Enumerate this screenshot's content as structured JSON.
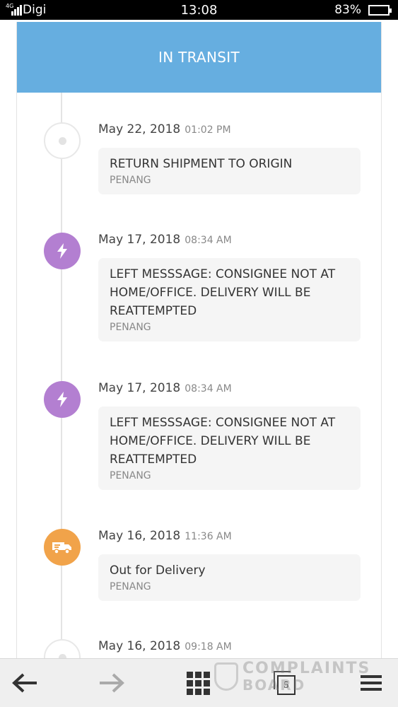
{
  "status_bar": {
    "signal_tag": "4G",
    "carrier": "Digi",
    "time": "13:08",
    "battery": "83%",
    "battery_level": 0.83
  },
  "header": {
    "title": "IN TRANSIT",
    "color": "#66aee0"
  },
  "events": [
    {
      "date": "May 22, 2018",
      "time": "01:02 PM",
      "message": "RETURN SHIPMENT TO ORIGIN",
      "location": "PENANG",
      "icon": "dot-icon",
      "color": "#ffffff"
    },
    {
      "date": "May 17, 2018",
      "time": "08:34 AM",
      "message": "LEFT MESSSAGE: CONSIGNEE NOT AT HOME/OFFICE. DELIVERY WILL BE REATTEMPTED",
      "location": "PENANG",
      "icon": "lightning-icon",
      "color": "#b37fd1"
    },
    {
      "date": "May 17, 2018",
      "time": "08:34 AM",
      "message": "LEFT MESSSAGE: CONSIGNEE NOT AT HOME/OFFICE. DELIVERY WILL BE REATTEMPTED",
      "location": "PENANG",
      "icon": "lightning-icon",
      "color": "#b37fd1"
    },
    {
      "date": "May 16, 2018",
      "time": "11:36 AM",
      "message": "Out for Delivery",
      "location": "PENANG",
      "icon": "delivery-truck-icon",
      "color": "#f1a34a"
    },
    {
      "date": "May 16, 2018",
      "time": "09:18 AM",
      "icon": "dot-icon",
      "color": "#ffffff"
    }
  ],
  "bottom_nav": {
    "back": "back-arrow-icon",
    "forward": "forward-arrow-icon",
    "apps": "grid-icon",
    "tabs": "tabs-icon",
    "tab_count": "5",
    "menu": "menu-icon"
  },
  "watermark": {
    "line1": "COMPLAINTS",
    "line2": "BOARD"
  }
}
